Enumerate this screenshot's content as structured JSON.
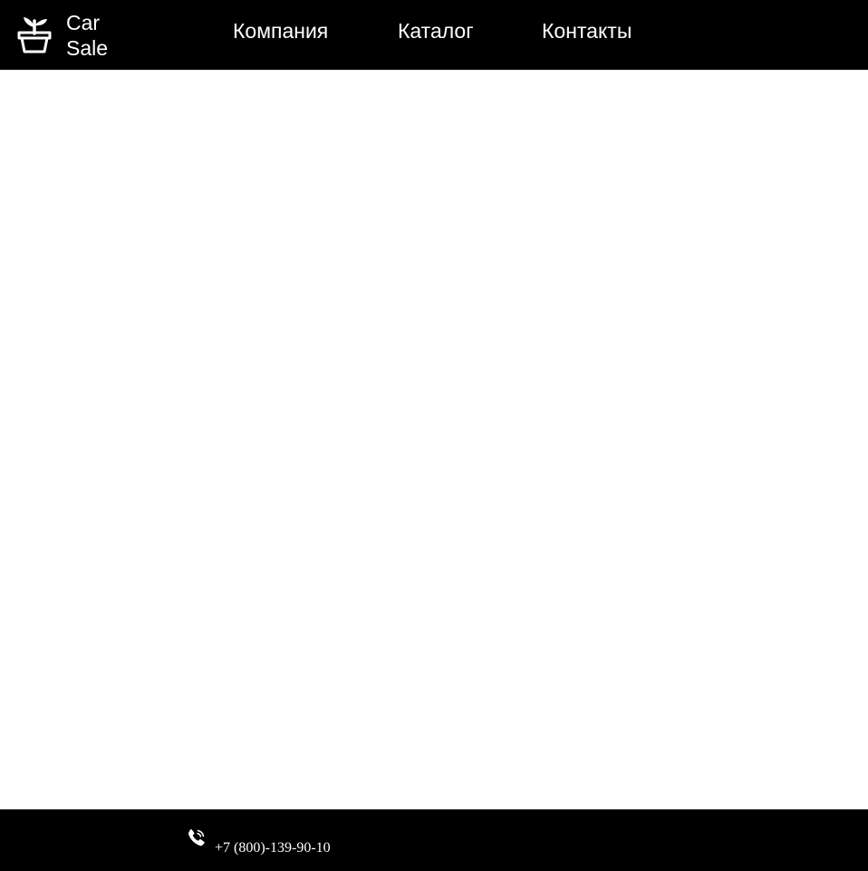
{
  "header": {
    "logo_icon": "plant-pot-icon",
    "brand_line1": "Car",
    "brand_line2": "Sale",
    "nav": {
      "company": "Компания",
      "catalog": "Каталог",
      "contacts": "Контакты"
    }
  },
  "footer": {
    "phone_icon": "phone-call-icon",
    "phone": "+7 (800)-139-90-10"
  },
  "colors": {
    "header_bg": "#000000",
    "footer_bg": "#000000",
    "text": "#ffffff",
    "page_bg": "#ffffff"
  }
}
